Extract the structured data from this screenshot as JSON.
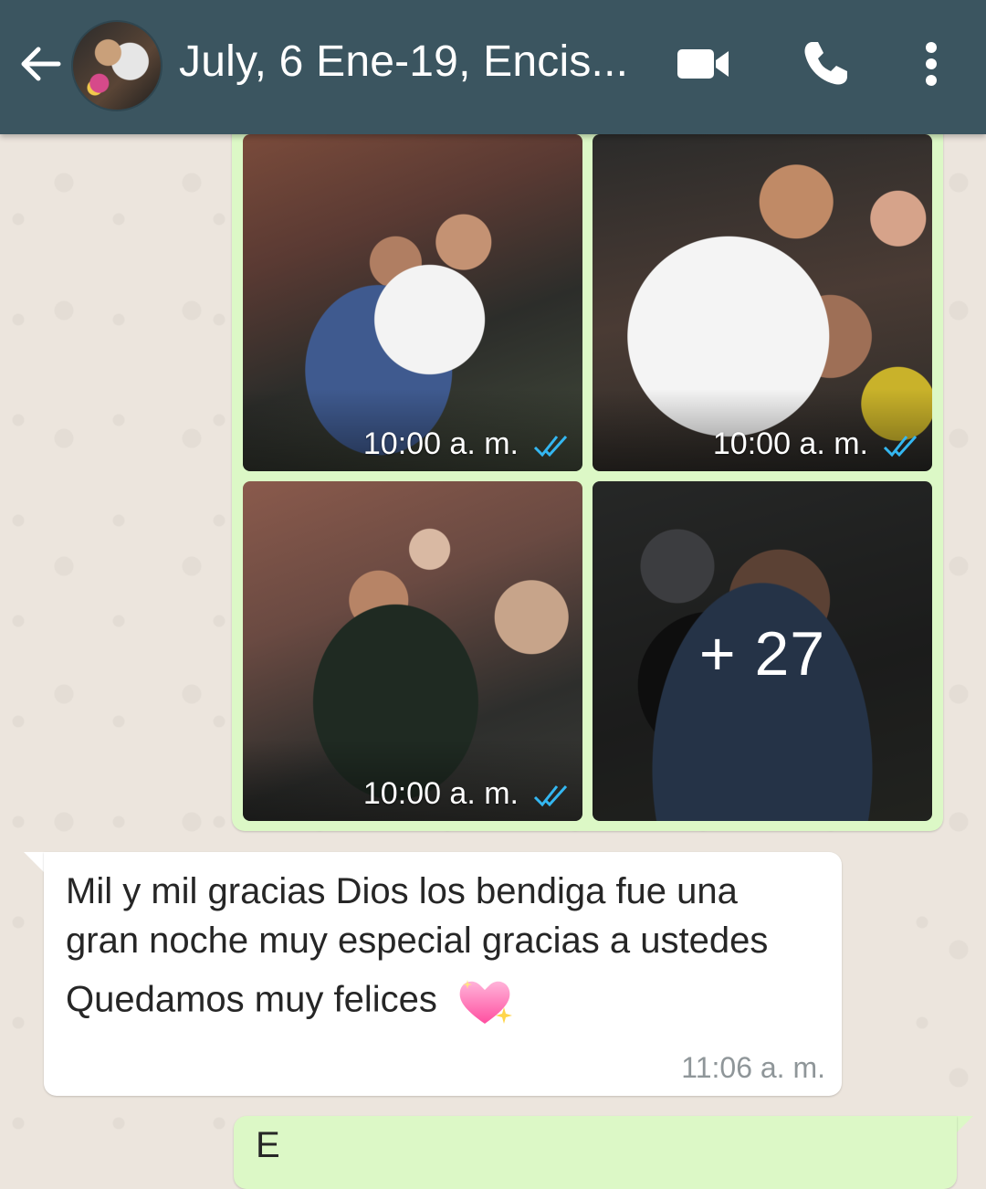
{
  "header": {
    "title": "July, 6 Ene-19, Encis...",
    "colors": {
      "bar": "#3b5560",
      "icon": "#ffffff"
    }
  },
  "media_group": {
    "items": [
      {
        "time": "10:00 a. m.",
        "status_icon": "double-check-read-icon"
      },
      {
        "time": "10:00 a. m.",
        "status_icon": "double-check-read-icon"
      },
      {
        "time": "10:00 a. m.",
        "status_icon": "double-check-read-icon"
      },
      {
        "more_count": "+ 27"
      }
    ],
    "bubble_color": "#dcf8c6",
    "tick_color": "#34b7f1"
  },
  "incoming_message": {
    "text_line1": "Mil y mil gracias Dios los bendiga fue una gran noche muy especial gracias a ustedes",
    "text_line2": "Quedamos muy felices",
    "emoji_icon": "sparkling-heart-icon",
    "time": "11:06 a. m."
  },
  "outgoing_message_partial": {
    "text": "E"
  }
}
